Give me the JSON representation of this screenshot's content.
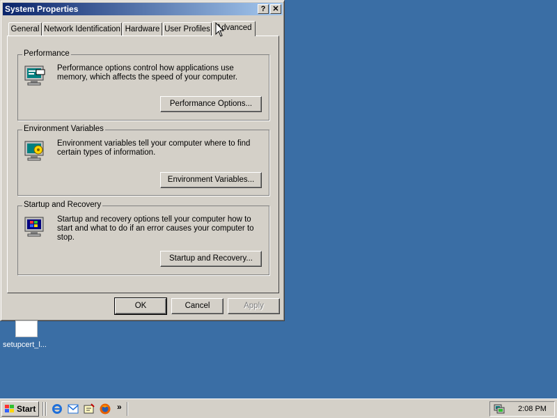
{
  "window": {
    "title": "System Properties",
    "help_label": "?",
    "close_label": "✕"
  },
  "tabs": [
    {
      "label": "General"
    },
    {
      "label": "Network Identification"
    },
    {
      "label": "Hardware"
    },
    {
      "label": "User Profiles"
    },
    {
      "label": "Advanced",
      "active": true
    }
  ],
  "groups": {
    "performance": {
      "title": "Performance",
      "text": "Performance options control how applications use memory, which affects the speed of your computer.",
      "button": "Performance Options..."
    },
    "environment": {
      "title": "Environment Variables",
      "text": "Environment variables tell your computer where to find certain types of information.",
      "button": "Environment Variables..."
    },
    "startup": {
      "title": "Startup and Recovery",
      "text": "Startup and recovery options tell your computer how to start and what to do if an error causes your computer to stop.",
      "button": "Startup and Recovery..."
    }
  },
  "footer": {
    "ok": "OK",
    "cancel": "Cancel",
    "apply": "Apply"
  },
  "desktop": {
    "icon_label": "setupcert_l..."
  },
  "taskbar": {
    "start_label": "Start",
    "chevron": "»",
    "clock": "2:08 PM"
  },
  "colors": {
    "desktop": "#3a6ea5",
    "title_start": "#0a246a",
    "title_end": "#a6caf0",
    "face": "#d4d0c8"
  }
}
